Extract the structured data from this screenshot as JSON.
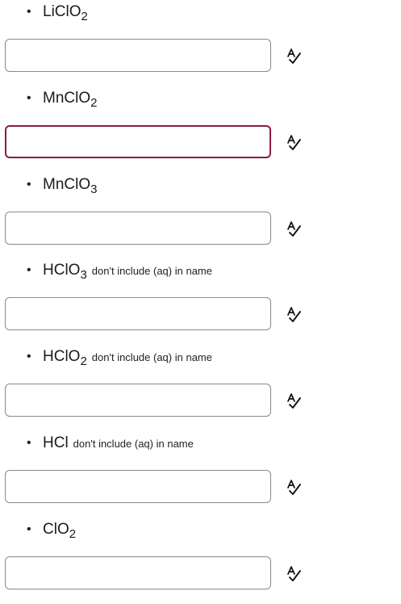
{
  "items": [
    {
      "formula_main": "LiClO",
      "formula_sub": "2",
      "note": "",
      "input_value": "",
      "placeholder": ""
    },
    {
      "formula_main": "MnClO",
      "formula_sub": "2",
      "note": "",
      "input_value": "",
      "placeholder": ""
    },
    {
      "formula_main": "MnClO",
      "formula_sub": "3",
      "note": "",
      "input_value": "",
      "placeholder": ""
    },
    {
      "formula_main": "HClO",
      "formula_sub": "3",
      "note": "don't include (aq) in name",
      "input_value": "",
      "placeholder": ""
    },
    {
      "formula_main": "HClO",
      "formula_sub": "2",
      "note": "don't include (aq) in name",
      "input_value": "",
      "placeholder": ""
    },
    {
      "formula_main": "HCl",
      "formula_sub": "",
      "note": "don't include (aq) in name",
      "input_value": "",
      "placeholder": ""
    },
    {
      "formula_main": "ClO",
      "formula_sub": "2",
      "note": "",
      "input_value": "",
      "placeholder": ""
    }
  ],
  "bullet": "•",
  "icons": {
    "spellcheck": "spellcheck-icon"
  },
  "colors": {
    "active_border": "#8a1c3c",
    "input_border": "#8a8a8a"
  }
}
